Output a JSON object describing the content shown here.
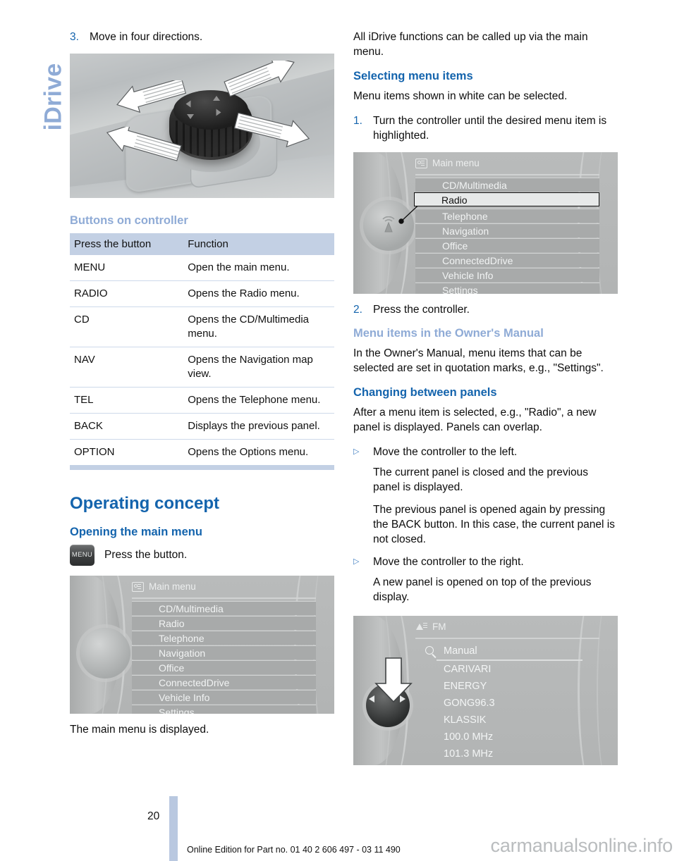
{
  "side_tab": "iDrive",
  "left_column": {
    "step3": {
      "num": "3.",
      "text": "Move in four directions."
    },
    "controller_photo_alt": "idrive-controller-four-directions",
    "heading_buttons": "Buttons on controller",
    "table": {
      "headers": [
        "Press the button",
        "Function"
      ],
      "rows": [
        [
          "MENU",
          "Open the main menu."
        ],
        [
          "RADIO",
          "Opens the Radio menu."
        ],
        [
          "CD",
          "Opens the CD/Multimedia menu."
        ],
        [
          "NAV",
          "Opens the Navigation map view."
        ],
        [
          "TEL",
          "Opens the Telephone menu."
        ],
        [
          "BACK",
          "Displays the previous panel."
        ],
        [
          "OPTION",
          "Opens the Options menu."
        ]
      ]
    },
    "heading_operating": "Operating concept",
    "heading_opening": "Opening the main menu",
    "menu_key_label": "MENU",
    "press_button_text": "Press the button.",
    "main_menu_screen": {
      "title": "Main menu",
      "icon": "menu-list-icon",
      "items": [
        "CD/Multimedia",
        "Radio",
        "Telephone",
        "Navigation",
        "Office",
        "ConnectedDrive",
        "Vehicle Info",
        "Settings"
      ]
    },
    "caption_main_menu": "The main menu is displayed."
  },
  "right_column": {
    "intro": "All iDrive functions can be called up via the main menu.",
    "heading_selecting": "Selecting menu items",
    "selecting_text": "Menu items shown in white can be selected.",
    "step1": {
      "num": "1.",
      "text": "Turn the controller until the desired menu item is highlighted."
    },
    "main_menu_screen": {
      "title": "Main menu",
      "icon": "menu-list-icon",
      "items": [
        "CD/Multimedia",
        "Radio",
        "Telephone",
        "Navigation",
        "Office",
        "ConnectedDrive",
        "Vehicle Info",
        "Settings"
      ],
      "selected_item": "Radio"
    },
    "step2": {
      "num": "2.",
      "text": "Press the controller."
    },
    "heading_owners_manual": "Menu items in the Owner's Manual",
    "owners_manual_text": "In the Owner's Manual, menu items that can be selected are set in quotation marks, e.g., \"Settings\".",
    "heading_changing": "Changing between panels",
    "changing_text": "After a menu item is selected, e.g., \"Radio\", a new panel is displayed. Panels can overlap.",
    "bullets": [
      {
        "marker": "▷",
        "text": "Move the controller to the left.",
        "sub": [
          "The current panel is closed and the previous panel is displayed.",
          "The previous panel is opened again by pressing the BACK button. In this case, the current panel is not closed."
        ]
      },
      {
        "marker": "▷",
        "text": "Move the controller to the right.",
        "sub": [
          "A new panel is opened on top of the previous display."
        ]
      }
    ],
    "fm_screen": {
      "title": "FM",
      "icon": "fm-antenna-icon",
      "search_label": "Manual",
      "search_icon": "magnifier-icon",
      "stations": [
        "CARIVARI",
        "ENERGY",
        "GONG96.3",
        "KLASSIK",
        "100.0  MHz",
        "101.3  MHz"
      ]
    }
  },
  "footer": {
    "page_number": "20",
    "note": "Online Edition for Part no. 01 40 2 606 497 - 03 11 490",
    "watermark": "carmanualsonline.info"
  },
  "colors": {
    "heading_blue": "#1464ad",
    "heading_light_blue": "#8fabd6",
    "table_header": "#c3d0e4",
    "footer_bar": "#b9c8e0"
  }
}
